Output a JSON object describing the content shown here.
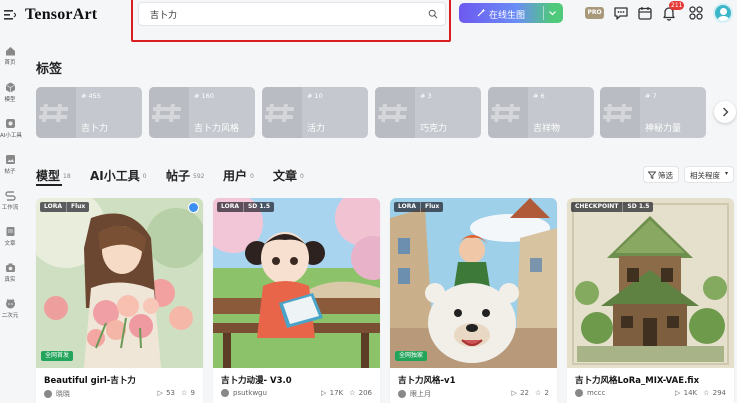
{
  "header": {
    "logo": "TensorArt",
    "search_value": "吉卜力",
    "generate_label": "在线生图",
    "pro_label": "PRO",
    "notification_count": "211"
  },
  "sidebar": {
    "items": [
      {
        "label": "首页",
        "icon": "home-icon"
      },
      {
        "label": "模型",
        "icon": "cube-icon"
      },
      {
        "label": "AI小工具",
        "icon": "tool-icon"
      },
      {
        "label": "帖子",
        "icon": "post-icon"
      },
      {
        "label": "工作流",
        "icon": "workflow-icon"
      },
      {
        "label": "文章",
        "icon": "article-icon"
      },
      {
        "label": "真实",
        "icon": "camera-icon"
      },
      {
        "label": "二次元",
        "icon": "anime-icon"
      }
    ]
  },
  "tags_section": {
    "title": "标签",
    "items": [
      {
        "count": "# 455",
        "name": "吉卜力"
      },
      {
        "count": "# 160",
        "name": "吉卜力风格"
      },
      {
        "count": "# 10",
        "name": "活力"
      },
      {
        "count": "# 3",
        "name": "巧克力"
      },
      {
        "count": "# 6",
        "name": "吉祥物"
      },
      {
        "count": "# 7",
        "name": "神秘力量"
      }
    ]
  },
  "tabs": [
    {
      "label": "模型",
      "count": "18"
    },
    {
      "label": "AI小工具",
      "count": "0"
    },
    {
      "label": "帖子",
      "count": "592"
    },
    {
      "label": "用户",
      "count": "0"
    },
    {
      "label": "文章",
      "count": "0"
    }
  ],
  "filter_label": "筛选",
  "sort_label": "相关程度",
  "cards": [
    {
      "tags": [
        "LORA",
        "Flux"
      ],
      "badge": "全网首发",
      "title": "Beautiful girl-吉卜力",
      "author": "晓晓",
      "runs": "53",
      "stars": "9"
    },
    {
      "tags": [
        "LORA",
        "SD 1.5"
      ],
      "badge": "",
      "title": "吉卜力动漫- V3.0",
      "author": "psutkwgu",
      "runs": "17K",
      "stars": "206"
    },
    {
      "tags": [
        "LORA",
        "Flux"
      ],
      "badge": "全网独家",
      "title": "吉卜力风格-v1",
      "author": "眼上月",
      "runs": "22",
      "stars": "2"
    },
    {
      "tags": [
        "CHECKPOINT",
        "SD 1.5"
      ],
      "badge": "",
      "title": "吉卜力风格LoRa_MIX-VAE.fix",
      "author": "mccc",
      "runs": "14K",
      "stars": "294"
    }
  ],
  "colors": {
    "accent_red": "#d81e1e",
    "generate_gradient_start": "#6d59f0",
    "generate_gradient_end": "#4fc97a",
    "badge_green": "#23a45b",
    "notification_red": "#e53935"
  }
}
